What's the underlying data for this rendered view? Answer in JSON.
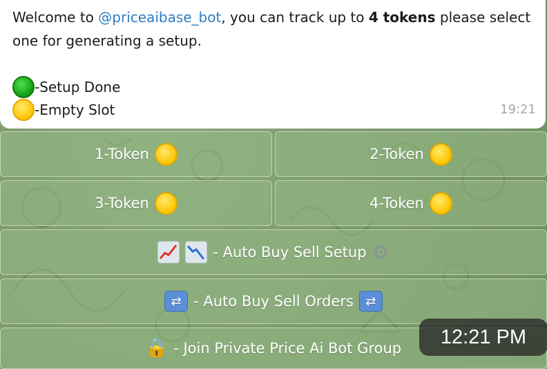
{
  "message": {
    "text_prefix": "Welcome to ",
    "mention": "@priceaibase_bot",
    "text_middle": ", you can track up to ",
    "bold": "4 tokens",
    "text_suffix": " please select one for generating a setup.",
    "legend": [
      {
        "icon": "green-circle",
        "label": "-Setup Done"
      },
      {
        "icon": "yellow-circle",
        "label": "-Empty Slot"
      }
    ],
    "time": "19:21"
  },
  "keyboard": {
    "token1": "1-Token",
    "token2": "2-Token",
    "token3": "3-Token",
    "token4": "4-Token",
    "setup": "- Auto Buy Sell Setup",
    "orders": "- Auto Buy Sell Orders",
    "join": "- Join Private Price Ai Bot Group"
  },
  "toast_time": "12:21 PM",
  "colors": {
    "mention": "#2e7dc5",
    "green_dot": "#119a11",
    "yellow_dot": "#ffc400"
  }
}
